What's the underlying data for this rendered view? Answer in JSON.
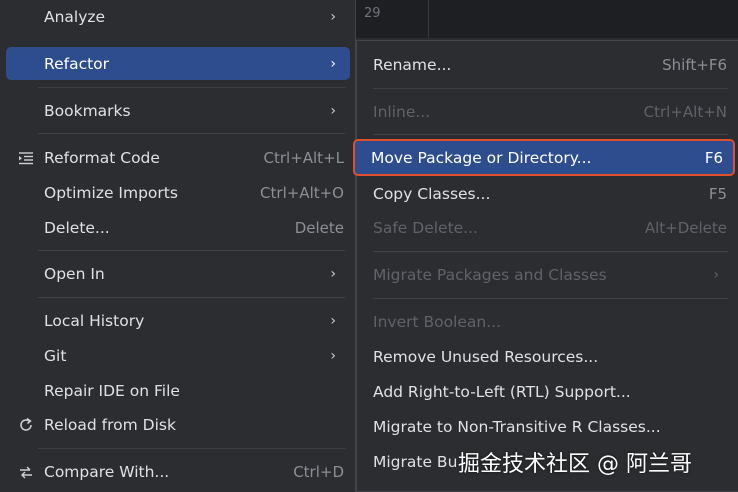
{
  "left_menu": {
    "analyze": "Analyze",
    "refactor": "Refactor",
    "bookmarks": "Bookmarks",
    "reformat_code": "Reformat Code",
    "reformat_code_shortcut": "Ctrl+Alt+L",
    "optimize_imports": "Optimize Imports",
    "optimize_imports_shortcut": "Ctrl+Alt+O",
    "delete": "Delete...",
    "delete_shortcut": "Delete",
    "open_in": "Open In",
    "local_history": "Local History",
    "git": "Git",
    "repair_ide": "Repair IDE on File",
    "reload_from_disk": "Reload from Disk",
    "compare_with": "Compare With...",
    "compare_with_shortcut": "Ctrl+D"
  },
  "editor": {
    "line_number": "29"
  },
  "submenu": {
    "rename": "Rename...",
    "rename_shortcut": "Shift+F6",
    "inline": "Inline...",
    "inline_shortcut": "Ctrl+Alt+N",
    "move_package": "Move Package or Directory...",
    "move_package_shortcut": "F6",
    "copy_classes": "Copy Classes...",
    "copy_classes_shortcut": "F5",
    "safe_delete": "Safe Delete...",
    "safe_delete_shortcut": "Alt+Delete",
    "migrate_packages": "Migrate Packages and Classes",
    "invert_boolean": "Invert Boolean...",
    "remove_unused": "Remove Unused Resources...",
    "add_rtl": "Add Right-to-Left (RTL) Support...",
    "migrate_r": "Migrate to Non-Transitive R Classes...",
    "migrate_build": "Migrate Bu"
  },
  "watermark": "掘金技术社区 @ 阿兰哥",
  "colors": {
    "menu_bg": "#2b2d30",
    "selection": "#2e4d8f",
    "highlight_border": "#e0502c",
    "disabled_text": "#5f6269"
  }
}
